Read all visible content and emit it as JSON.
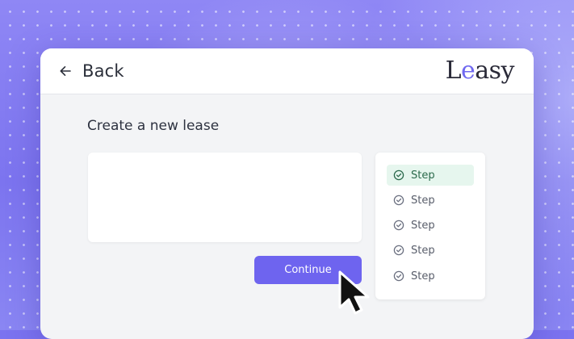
{
  "header": {
    "back_label": "Back",
    "logo_text_1": "L",
    "logo_text_2": "e",
    "logo_text_3": "asy"
  },
  "main": {
    "title": "Create a new lease",
    "continue_label": "Continue"
  },
  "steps": [
    {
      "label": "Step",
      "active": true
    },
    {
      "label": "Step",
      "active": false
    },
    {
      "label": "Step",
      "active": false
    },
    {
      "label": "Step",
      "active": false
    },
    {
      "label": "Step",
      "active": false
    }
  ],
  "colors": {
    "accent": "#6e64ef",
    "active_step_bg": "#e6f6ee",
    "active_step_text": "#2b6a4c"
  },
  "icons": {
    "back": "arrow-left-icon",
    "step": "check-circle-icon",
    "cursor": "mouse-pointer-icon"
  }
}
